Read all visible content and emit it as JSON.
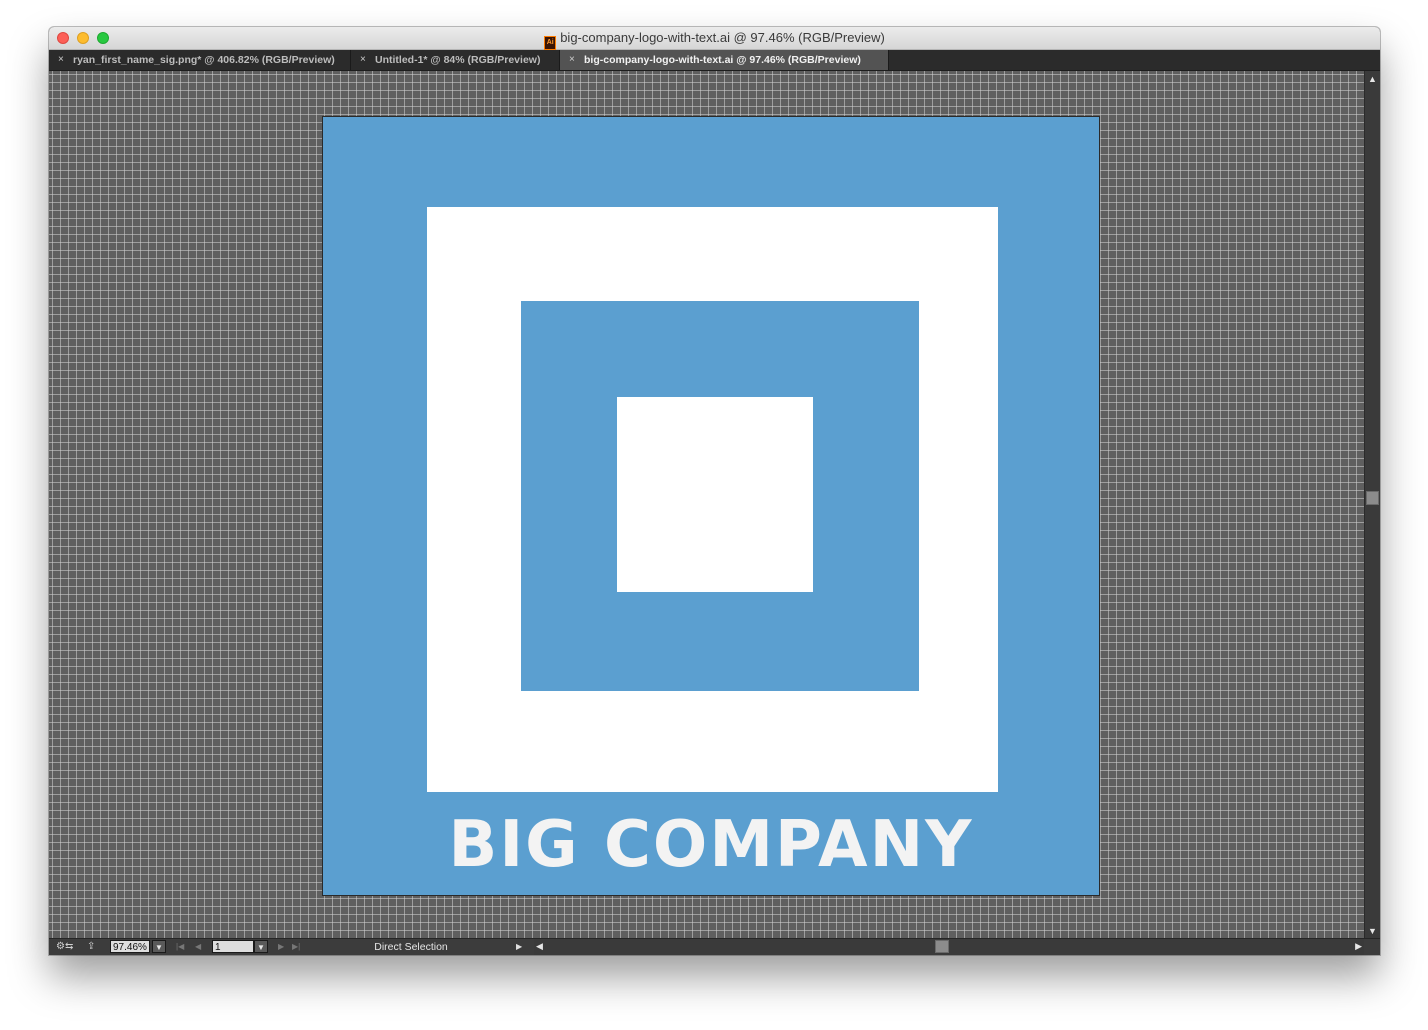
{
  "window": {
    "title": "big-company-logo-with-text.ai @ 97.46% (RGB/Preview)"
  },
  "tabs": [
    {
      "label": "ryan_first_name_sig.png* @ 406.82% (RGB/Preview)",
      "active": false
    },
    {
      "label": "Untitled-1* @ 84% (RGB/Preview)",
      "active": false
    },
    {
      "label": "big-company-logo-with-text.ai @ 97.46% (RGB/Preview)",
      "active": true
    }
  ],
  "tab_close_glyph": "×",
  "artboard": {
    "logo_text": "BIG COMPANY",
    "colors": {
      "blue": "#5b9fd0",
      "white": "#ffffff",
      "text": "#f3f3f3"
    }
  },
  "statusbar": {
    "zoom": "97.46%",
    "page": "1",
    "tool": "Direct Selection"
  },
  "icons": {
    "file_type": "illustrator-file-icon",
    "status_left": "toggle-status-icon",
    "share": "share-icon",
    "first_page": "first-page-icon",
    "prev_page": "previous-page-icon",
    "next_page": "next-page-icon",
    "last_page": "last-page-icon"
  }
}
